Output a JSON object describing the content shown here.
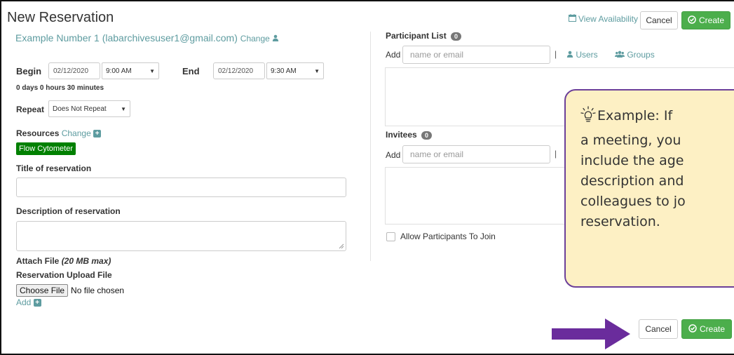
{
  "header": {
    "title": "New Reservation",
    "view_availability": "View Availability",
    "cancel_label": "Cancel",
    "create_label": "Create"
  },
  "user": {
    "name_email": "Example Number 1 (labarchivesuser1@gmail.com)",
    "change_label": "Change"
  },
  "time": {
    "begin_label": "Begin",
    "begin_date": "02/12/2020",
    "begin_time": "9:00 AM",
    "end_label": "End",
    "end_date": "02/12/2020",
    "end_time": "9:30 AM",
    "duration": "0 days 0 hours 30 minutes"
  },
  "repeat": {
    "label": "Repeat",
    "value": "Does Not Repeat"
  },
  "resources": {
    "label": "Resources",
    "change_label": "Change",
    "items": [
      "Flow Cytometer"
    ],
    "item_color": "#008000"
  },
  "form": {
    "title_label": "Title of reservation",
    "title_value": "",
    "description_label": "Description of reservation",
    "description_value": "",
    "attach_label": "Attach File",
    "attach_limit": "(20 MB max)",
    "upload_label": "Reservation Upload File",
    "choose_file_label": "Choose File",
    "no_file_text": "No file chosen",
    "add_label": "Add"
  },
  "participants": {
    "label": "Participant List",
    "count": "0",
    "add_label": "Add",
    "placeholder": "name or email",
    "separator": "|",
    "users_label": "Users",
    "groups_label": "Groups"
  },
  "invitees": {
    "label": "Invitees",
    "count": "0",
    "add_label": "Add",
    "placeholder": "name or email",
    "separator": "|"
  },
  "allow_join": {
    "label": "Allow Participants To Join",
    "checked": false
  },
  "footer": {
    "cancel_label": "Cancel",
    "create_label": "Create"
  },
  "callout": {
    "lines": [
      "Example: If",
      "a meeting, you",
      "include the age",
      "description and",
      "colleagues to jo",
      "reservation."
    ],
    "background": "#fdf0c4",
    "border_color": "#6c3f99"
  },
  "colors": {
    "accent": "#5e9ca0",
    "create_green": "#4cae4c",
    "arrow": "#6a2c9c"
  }
}
